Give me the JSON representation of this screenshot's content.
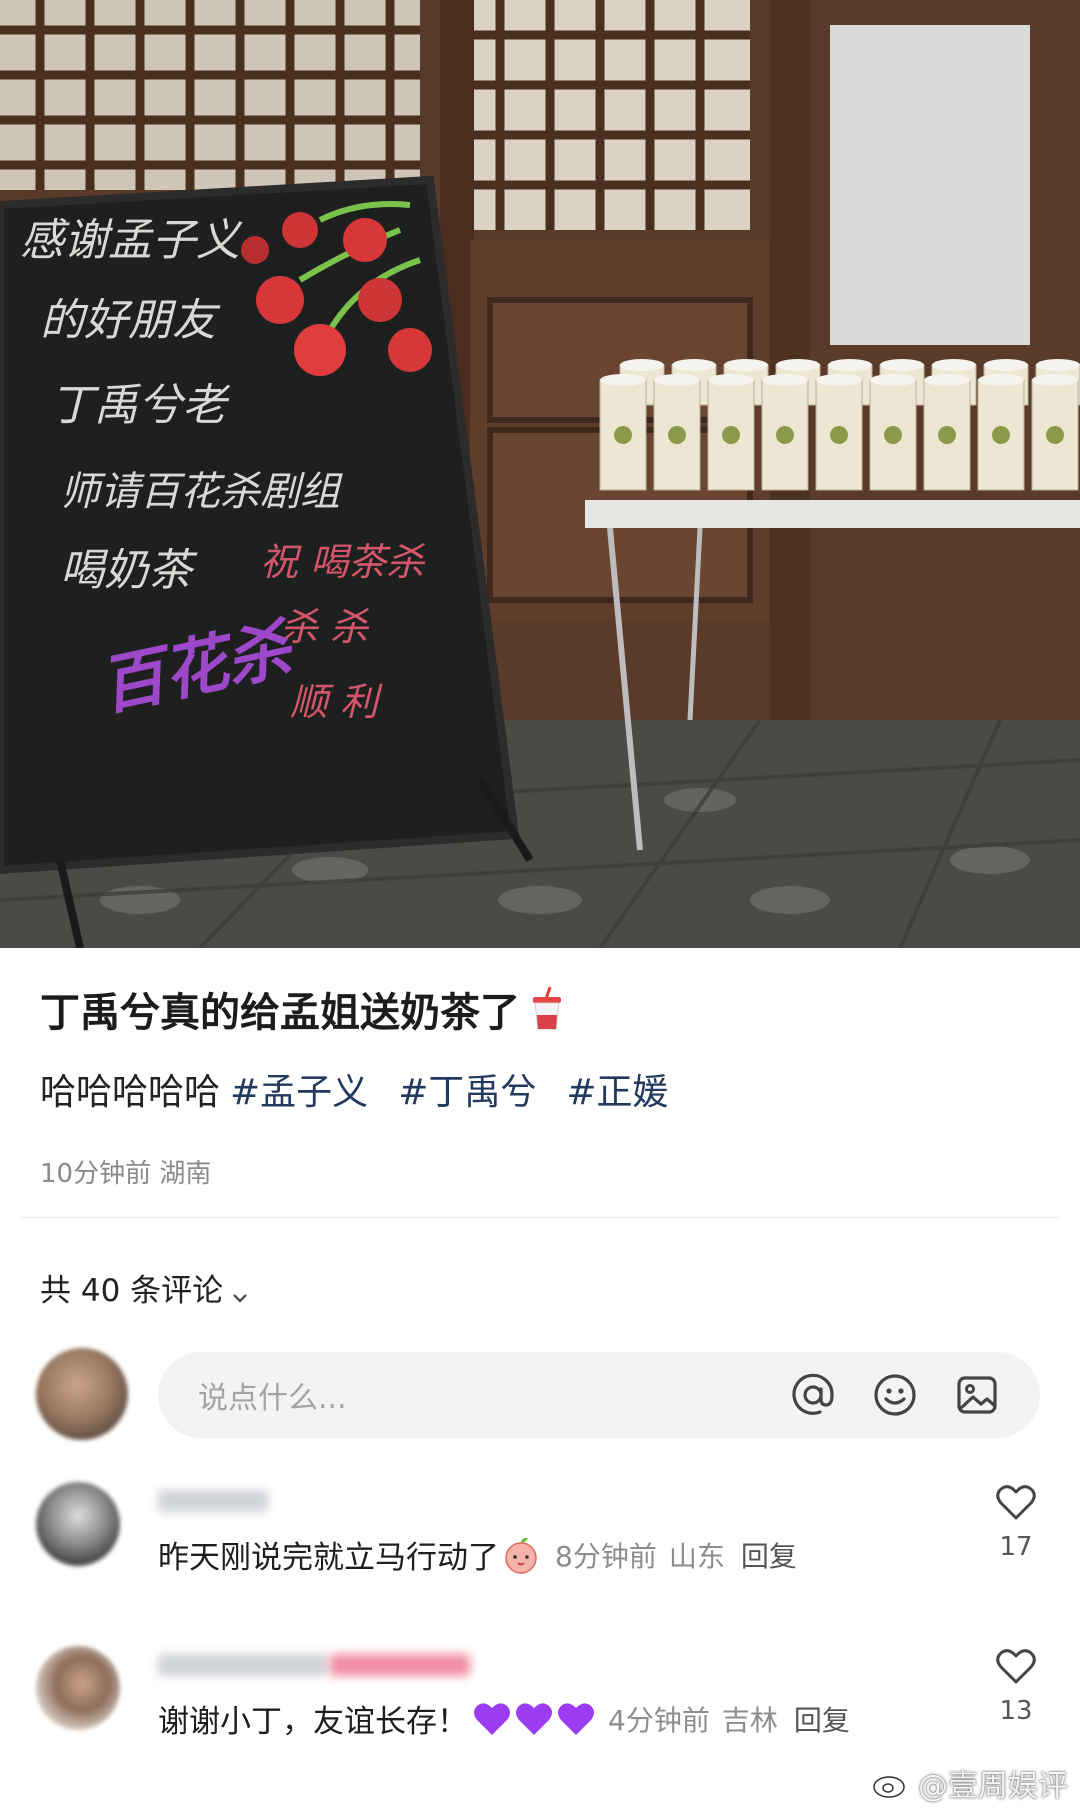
{
  "post": {
    "title": "丁禹兮真的给孟姐送奶茶了",
    "title_icon": "bubble-tea-cup",
    "content_prefix": "哈哈哈哈哈",
    "hashtags": [
      "#孟子义",
      "#丁禹兮",
      "#正媛"
    ],
    "time": "10分钟前",
    "location": "湖南"
  },
  "photo": {
    "chalkboard_lines": [
      "感谢孟子义",
      "的好朋友",
      "丁禹兮老",
      "师请百花杀剧组",
      "喝奶茶"
    ],
    "chalkboard_red": [
      "祝 喝茶杀",
      "杀 杀",
      "顺 利"
    ],
    "chalkboard_purple": "百花杀"
  },
  "comments_header": {
    "label": "共 40 条评论"
  },
  "input": {
    "placeholder": "说点什么...",
    "icons": [
      "at-icon",
      "emoji-icon",
      "image-icon"
    ]
  },
  "comments": [
    {
      "text": "昨天刚说完就立马行动了",
      "time": "8分钟前",
      "location": "山东",
      "reply": "回复",
      "likes": "17"
    },
    {
      "text": "谢谢小丁，友谊长存！",
      "time": "4分钟前",
      "location": "吉林",
      "reply": "回复",
      "likes": "13"
    }
  ],
  "watermark": "@壹周娱评",
  "colors": {
    "hashtag": "#23395d",
    "meta": "#8a8a8a",
    "input_bg": "#f3f3f5",
    "heart_purple": "#9b3cf0"
  }
}
